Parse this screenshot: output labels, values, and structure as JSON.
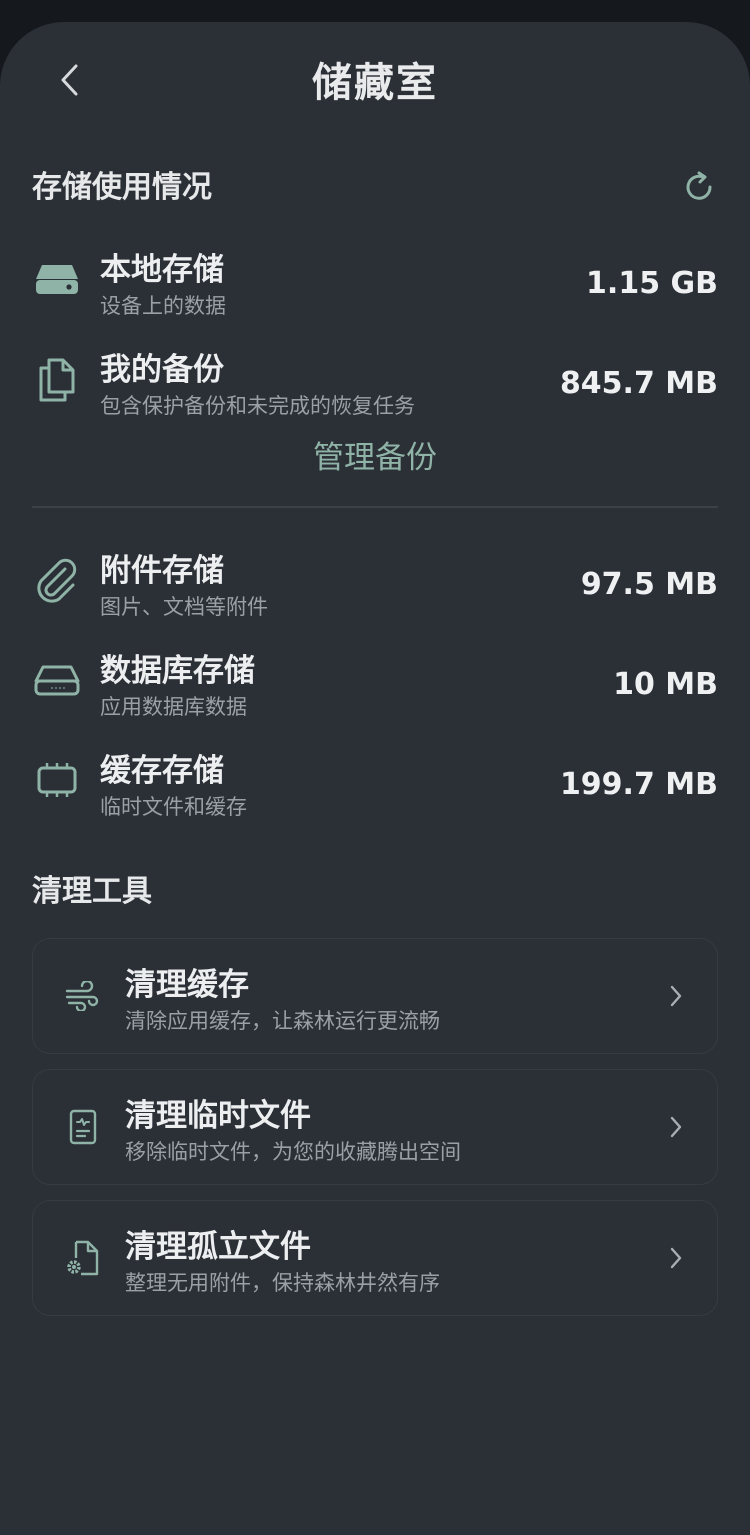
{
  "header": {
    "title": "储藏室",
    "back_icon": "chevron-left-icon"
  },
  "usage_section": {
    "title": "存储使用情况",
    "refresh_icon": "refresh-icon",
    "items": [
      {
        "label": "本地存储",
        "desc": "设备上的数据",
        "size": "1.15 GB",
        "icon": "drive-icon"
      },
      {
        "label": "我的备份",
        "desc": "包含保护备份和未完成的恢复任务",
        "size": "845.7 MB",
        "icon": "documents-icon"
      },
      {
        "label": "附件存储",
        "desc": "图片、文档等附件",
        "size": "97.5 MB",
        "icon": "paperclip-icon"
      },
      {
        "label": "数据库存储",
        "desc": "应用数据库数据",
        "size": "10 MB",
        "icon": "database-icon"
      },
      {
        "label": "缓存存储",
        "desc": "临时文件和缓存",
        "size": "199.7 MB",
        "icon": "chip-icon"
      }
    ],
    "manage_backups_label": "管理备份"
  },
  "tools_section": {
    "title": "清理工具",
    "items": [
      {
        "label": "清理缓存",
        "desc": "清除应用缓存，让森林运行更流畅",
        "icon": "wind-icon"
      },
      {
        "label": "清理临时文件",
        "desc": "移除临时文件，为您的收藏腾出空间",
        "icon": "file-note-icon"
      },
      {
        "label": "清理孤立文件",
        "desc": "整理无用附件，保持森林井然有序",
        "icon": "file-gear-icon"
      }
    ]
  },
  "colors": {
    "background": "#2b2f36",
    "accent": "#8fb3a6",
    "text_primary": "#eceef0",
    "text_secondary": "#9aa0a6"
  }
}
